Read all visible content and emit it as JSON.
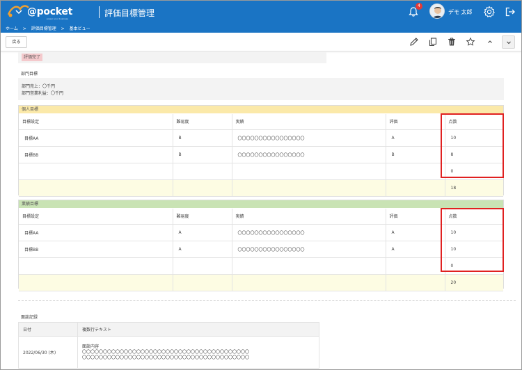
{
  "header": {
    "logo_text": "@pocket",
    "logo_sub": "power your business",
    "app_title": "評価目標管理",
    "notification_count": "4",
    "user_name": "デモ 太郎",
    "brand_color": "#1a74c4"
  },
  "breadcrumb": [
    "ホーム",
    ">",
    "評価目標管理",
    ">",
    "基本ビュー"
  ],
  "toolbar": {
    "back_label": "戻る",
    "icons": [
      "pencil-icon",
      "copy-icon",
      "trash-icon",
      "star-icon",
      "chevron-up-icon",
      "chevron-down-icon"
    ]
  },
  "status": {
    "badge": "評価完了",
    "badge_color": "#f4c9cc"
  },
  "department": {
    "label": "部門目標",
    "lines": [
      "部門売上：〇千円",
      "部門営業利益：〇千円"
    ]
  },
  "personal": {
    "title": "個人目標",
    "header_color": "#fbe9a9",
    "columns": [
      "目標設定",
      "難易度",
      "実績",
      "評価",
      "点数"
    ],
    "rows": [
      [
        "目標AA",
        "B",
        "〇〇〇〇〇〇〇〇〇〇〇〇〇〇〇〇",
        "A",
        "10"
      ],
      [
        "目標BB",
        "B",
        "〇〇〇〇〇〇〇〇〇〇〇〇〇〇〇〇",
        "B",
        "8"
      ],
      [
        "",
        "",
        "",
        "",
        "0"
      ]
    ],
    "total": "18"
  },
  "business": {
    "title": "業績目標",
    "header_color": "#c9e3b4",
    "columns": [
      "目標設定",
      "難易度",
      "実績",
      "評価",
      "点数"
    ],
    "rows": [
      [
        "目標AA",
        "A",
        "〇〇〇〇〇〇〇〇〇〇〇〇〇〇〇〇",
        "A",
        "10"
      ],
      [
        "目標BB",
        "A",
        "〇〇〇〇〇〇〇〇〇〇〇〇〇〇〇〇",
        "A",
        "10"
      ],
      [
        "",
        "",
        "",
        "",
        "0"
      ]
    ],
    "total": "20"
  },
  "interview": {
    "label": "面談記録",
    "columns": [
      "日付",
      "複数行テキスト"
    ],
    "date": "2022/06/30 (木)",
    "memo_lines": [
      "面談内容",
      "〇〇〇〇〇〇〇〇〇〇〇〇〇〇〇〇〇〇〇〇〇〇〇〇〇〇〇〇〇〇〇〇〇〇〇〇〇〇〇〇",
      "〇〇〇〇〇〇〇〇〇〇〇〇〇〇〇〇〇〇〇〇〇〇〇〇〇〇〇〇〇〇〇〇〇〇〇〇〇〇〇〇"
    ]
  }
}
